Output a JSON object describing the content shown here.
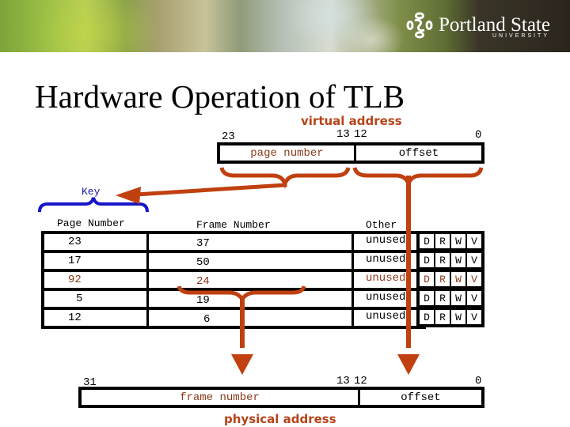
{
  "header": {
    "institution": "Portland State",
    "institution_sub": "UNIVERSITY",
    "logo_icon": "psu-logo-icon"
  },
  "slide": {
    "title": "Hardware Operation of TLB"
  },
  "virtual_address": {
    "label": "virtual address",
    "bits": {
      "high": "23",
      "mid_high": "13",
      "mid_low": "12",
      "low": "0"
    },
    "fields": {
      "page_number": "page number",
      "offset": "offset"
    }
  },
  "physical_address": {
    "label": "physical address",
    "bits": {
      "high": "31",
      "mid_high": "13",
      "mid_low": "12",
      "low": "0"
    },
    "fields": {
      "frame_number": "frame number",
      "offset": "offset"
    }
  },
  "tlb": {
    "key_label": "Key",
    "columns": {
      "page_number": "Page Number",
      "frame_number": "Frame Number",
      "other": "Other"
    },
    "rows": [
      {
        "page": "23",
        "frame": "37",
        "other": "unused",
        "flags": [
          "D",
          "R",
          "W",
          "V"
        ],
        "highlight": false
      },
      {
        "page": "17",
        "frame": "50",
        "other": "unused",
        "flags": [
          "D",
          "R",
          "W",
          "V"
        ],
        "highlight": false
      },
      {
        "page": "92",
        "frame": "24",
        "other": "unused",
        "flags": [
          "D",
          "R",
          "W",
          "V"
        ],
        "highlight": true
      },
      {
        "page": "5",
        "frame": "19",
        "other": "unused",
        "flags": [
          "D",
          "R",
          "W",
          "V"
        ],
        "highlight": false
      },
      {
        "page": "12",
        "frame": "6",
        "other": "unused",
        "flags": [
          "D",
          "R",
          "W",
          "V"
        ],
        "highlight": false
      }
    ]
  },
  "colors": {
    "arrow": "#c0400f",
    "key_brace": "#1515c8",
    "highlight_text": "#8a3a1a"
  }
}
